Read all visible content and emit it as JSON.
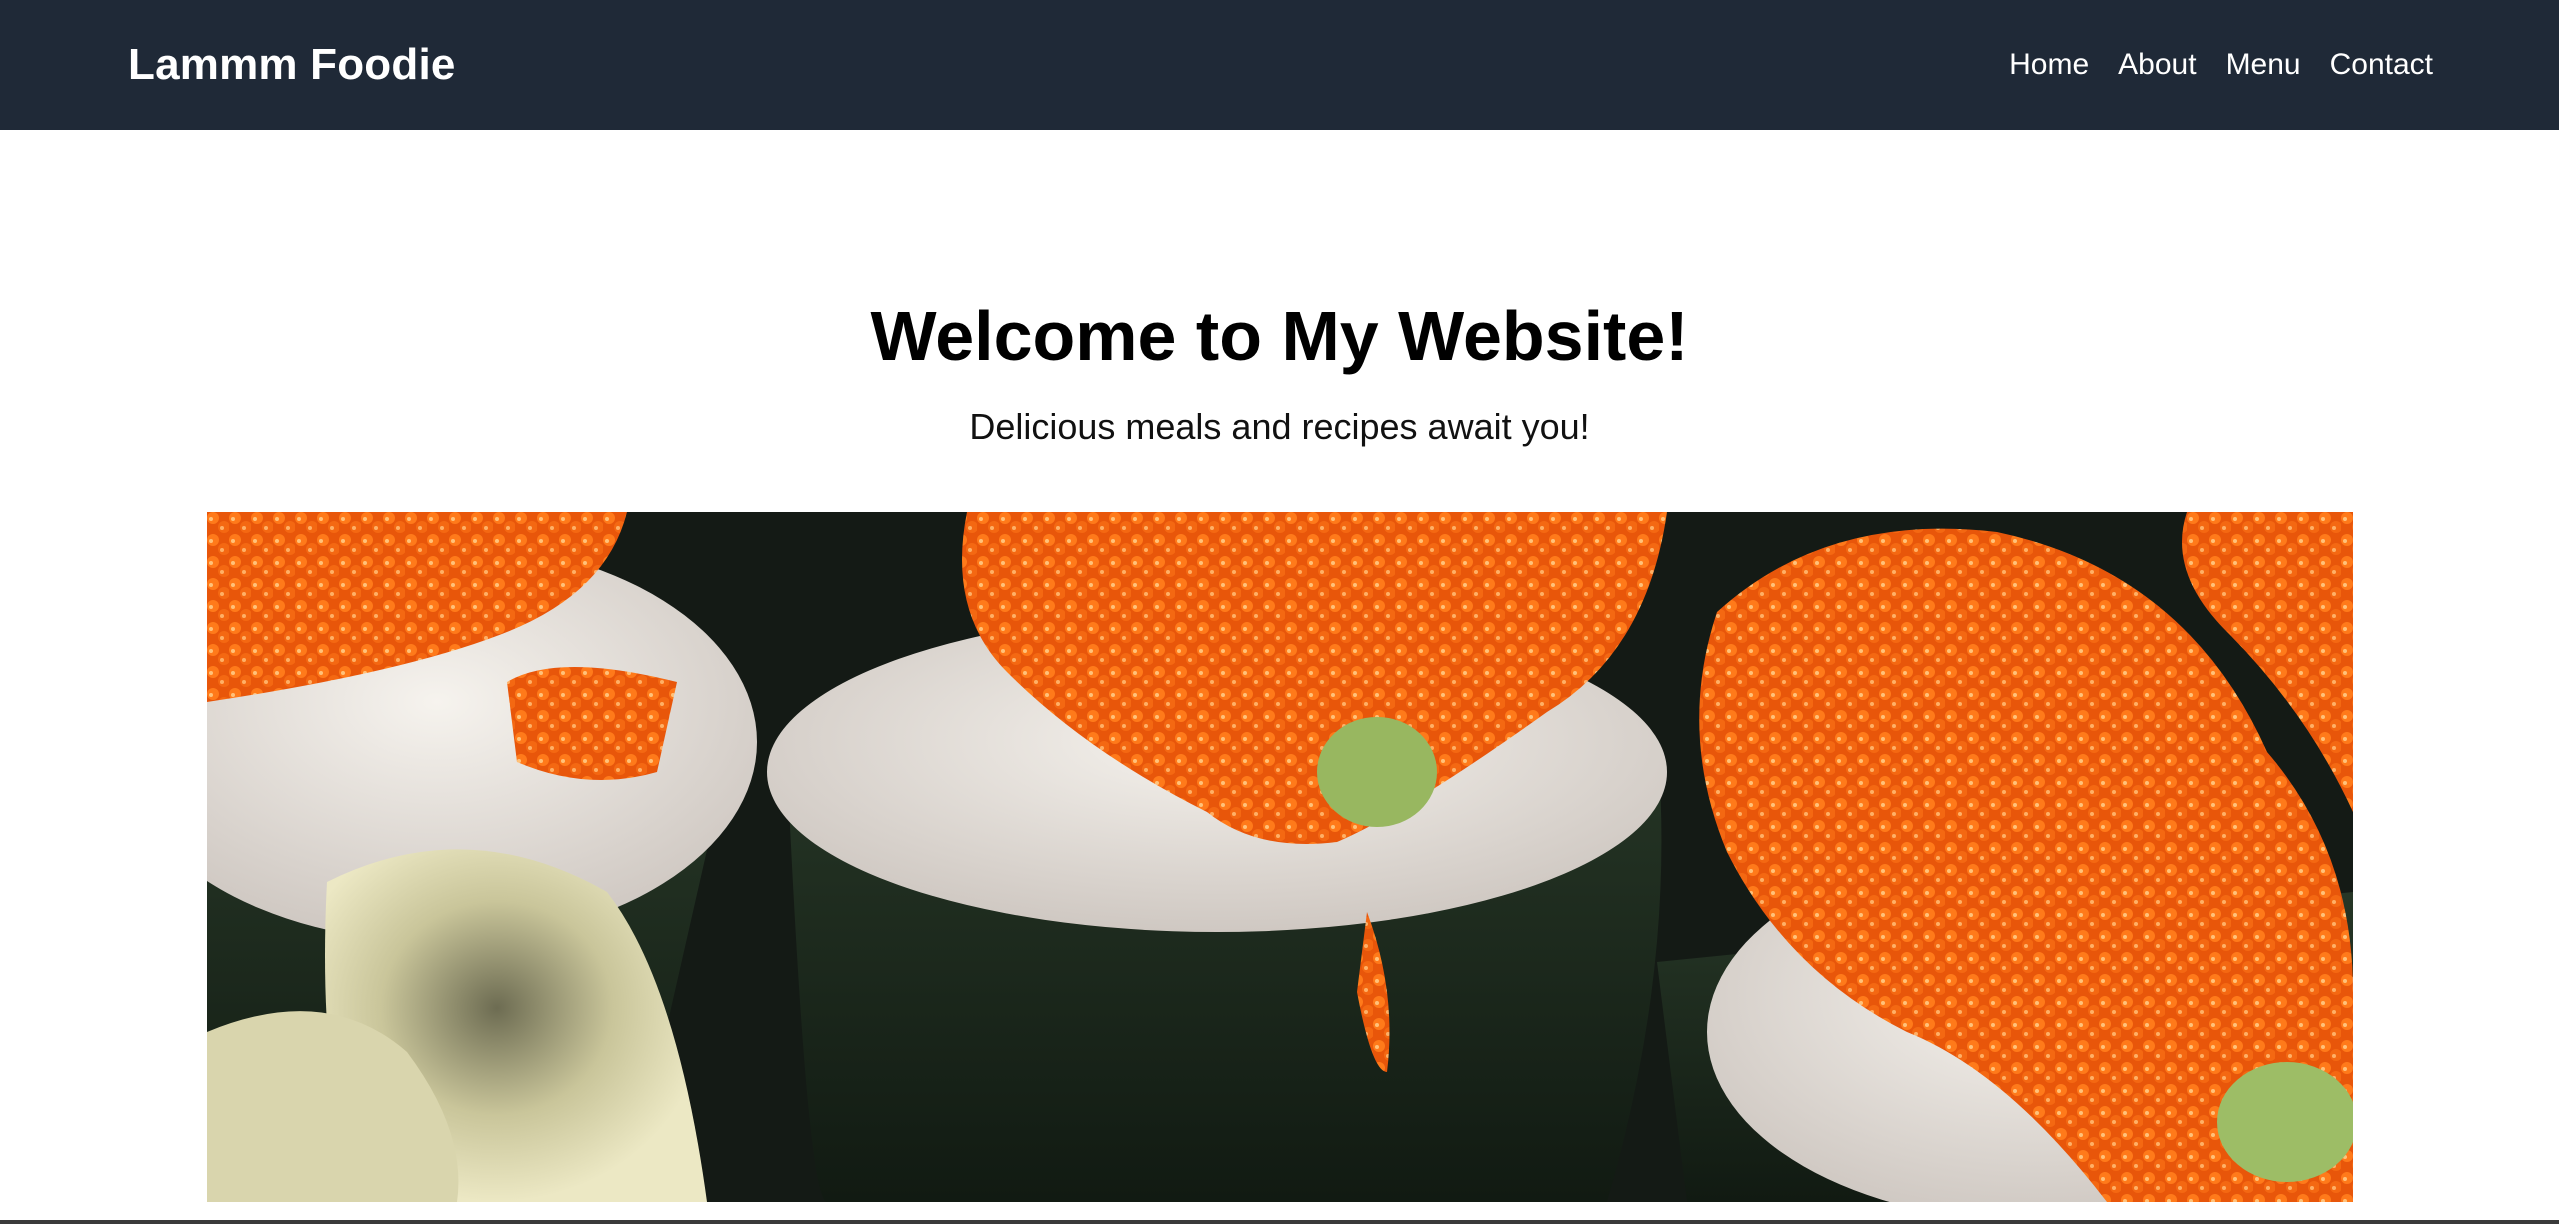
{
  "header": {
    "brand": "Lammm Foodie",
    "nav": [
      "Home",
      "About",
      "Menu",
      "Contact"
    ]
  },
  "hero": {
    "title": "Welcome to My Website!",
    "subtitle": "Delicious meals and recipes await you!"
  },
  "colors": {
    "navbar_bg": "#1f2937",
    "nav_text": "#ffffff",
    "page_bg": "#ffffff",
    "roe_orange": "#f26a10",
    "seaweed": "#1c2a1e",
    "rice": "#ece8e2",
    "ginger": "#e7e2b8"
  }
}
